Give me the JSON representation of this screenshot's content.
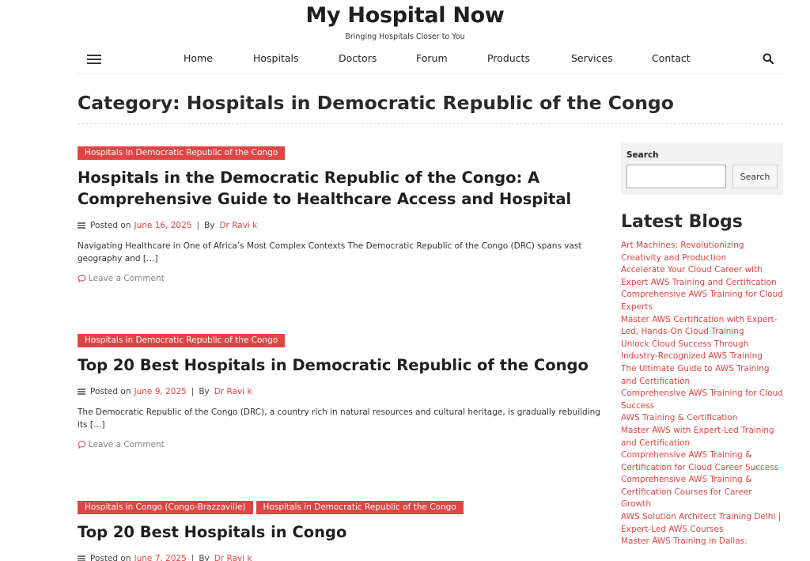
{
  "header": {
    "site_title": "My Hospital Now",
    "tagline": "Bringing Hospitals Closer to You"
  },
  "nav": {
    "items": [
      "Home",
      "Hospitals",
      "Doctors",
      "Forum",
      "Products",
      "Services",
      "Contact"
    ],
    "menu_icon": "hamburger-icon",
    "search_icon": "search-icon"
  },
  "category": {
    "title": "Category: Hospitals in Democratic Republic of the Congo"
  },
  "posts": [
    {
      "tags": [
        "Hospitals in Democratic Republic of the Congo"
      ],
      "title": "Hospitals in the Democratic Republic of the Congo: A Comprehensive Guide to Healthcare Access and Hospital",
      "posted_on_label": "Posted on",
      "date": "June 16, 2025",
      "by_label": "By",
      "author": "Dr Ravi k",
      "excerpt": "Navigating Healthcare in One of Africa’s Most Complex Contexts The Democratic Republic of the Congo (DRC) spans vast geography and […]",
      "comment_label": "Leave a Comment"
    },
    {
      "tags": [
        "Hospitals in Democratic Republic of the Congo"
      ],
      "title": "Top 20 Best Hospitals in Democratic Republic of the Congo",
      "posted_on_label": "Posted on",
      "date": "June 9, 2025",
      "by_label": "By",
      "author": "Dr Ravi k",
      "excerpt": "The Democratic Republic of the Congo (DRC), a country rich in natural resources and cultural heritage, is gradually rebuilding its […]",
      "comment_label": "Leave a Comment"
    },
    {
      "tags": [
        "Hospitals in Congo (Congo-Brazzaville)",
        "Hospitals in Democratic Republic of the Congo"
      ],
      "title": "Top 20 Best Hospitals in Congo",
      "posted_on_label": "Posted on",
      "date": "June 7, 2025",
      "by_label": "By",
      "author": "Dr Ravi k"
    }
  ],
  "sidebar": {
    "search": {
      "label": "Search",
      "input_value": "",
      "placeholder": "",
      "button_label": "Search"
    },
    "latest_title": "Latest Blogs",
    "latest_items": [
      "Art Machines: Revolutionizing Creativity and Production",
      "Accelerate Your Cloud Career with Expert AWS Training and Certification",
      "Comprehensive AWS Training for Cloud Experts",
      "Master AWS Certification with Expert-Led, Hands-On Cloud Training",
      "Unlock Cloud Success Through Industry-Recognized AWS Training",
      "The Ultimate Guide to AWS Training and Certification",
      "Comprehensive AWS Training for Cloud Success",
      "AWS Training & Certification",
      "Master AWS with Expert-Led Training and Certification",
      "Comprehensive AWS Training & Certification for Cloud Career Success",
      "Comprehensive AWS Training & Certification Courses for Career Growth",
      "AWS Solution Architect Training Delhi | Expert-Led AWS Courses",
      "Master AWS Training in Dallas:"
    ]
  },
  "colors": {
    "accent": "#e04545",
    "text": "#222222",
    "widget_bg": "#f2f2f2"
  }
}
